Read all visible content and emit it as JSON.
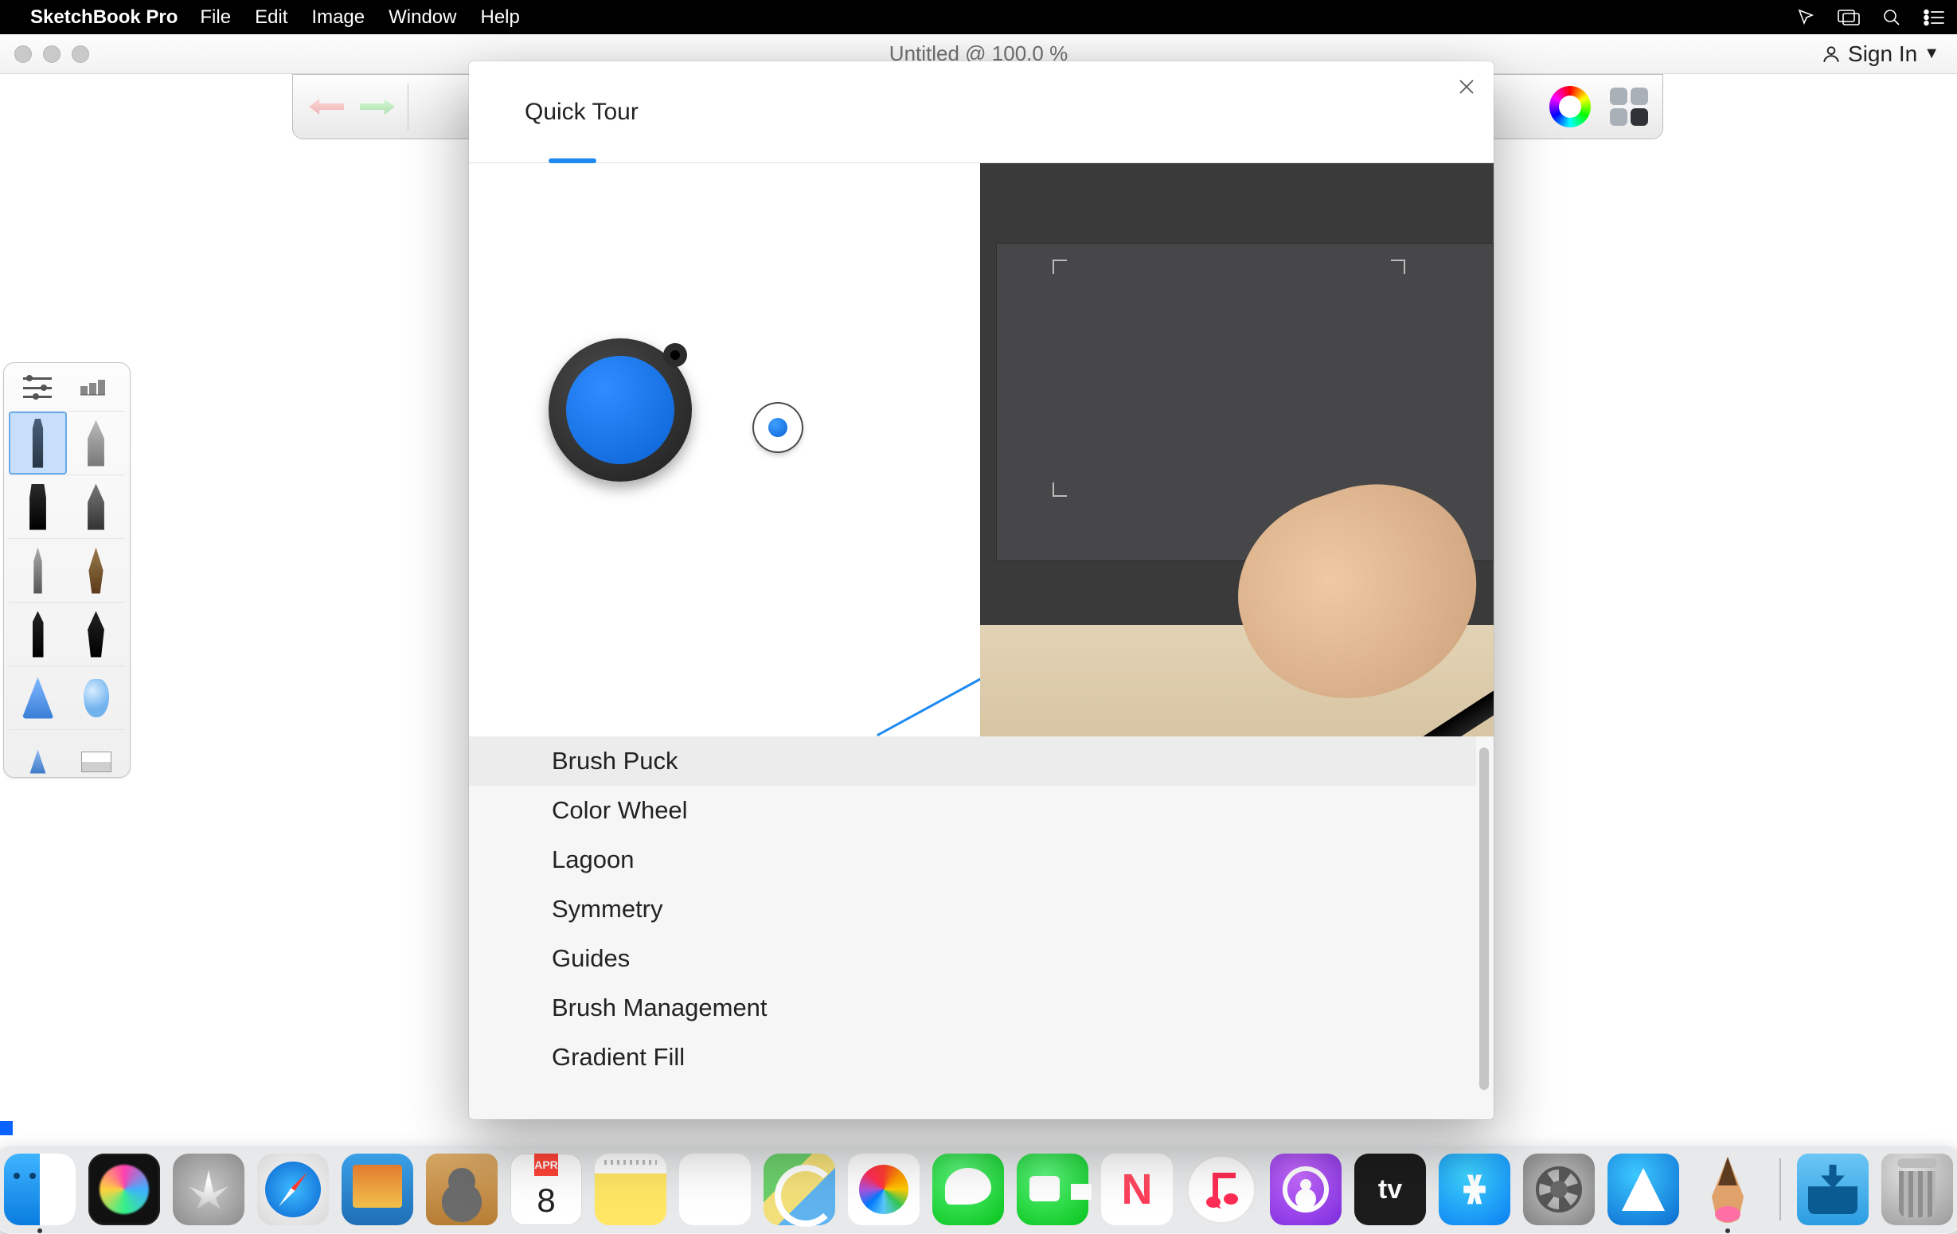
{
  "menubar": {
    "app_name": "SketchBook Pro",
    "items": [
      "File",
      "Edit",
      "Image",
      "Window",
      "Help"
    ]
  },
  "window": {
    "title": "Untitled @ 100.0 %",
    "signin_label": "Sign In"
  },
  "toolbar": {
    "undo_name": "undo",
    "redo_name": "redo",
    "color_wheel_name": "color-wheel",
    "ui_toggle_name": "ui-panels"
  },
  "brush_palette": {
    "brushes": [
      "Pencil",
      "Technical Pen",
      "Marker",
      "Chisel Marker",
      "Ballpoint",
      "Brush Pen",
      "Fine Liner",
      "Ink Brush",
      "Airbrush Cone",
      "Soft Airbrush",
      "Hard Cone",
      "Paint Swatch"
    ],
    "selected_index": 0
  },
  "quick_tour": {
    "title": "Quick Tour",
    "items": [
      "Brush Puck",
      "Color Wheel",
      "Lagoon",
      "Symmetry",
      "Guides",
      "Brush Management",
      "Gradient Fill"
    ],
    "selected_index": 0
  },
  "calendar": {
    "month": "APR",
    "day": "8"
  },
  "dock": {
    "apps": [
      "Finder",
      "Siri",
      "Launchpad",
      "Safari",
      "Preview",
      "Contacts",
      "Calendar",
      "Notes",
      "Reminders",
      "Maps",
      "Photos",
      "Messages",
      "FaceTime",
      "News",
      "Music",
      "Podcasts",
      "TV",
      "App Store",
      "System Preferences",
      "Affinity",
      "SketchBook"
    ],
    "right": [
      "Downloads",
      "Trash"
    ],
    "running": [
      "Finder",
      "SketchBook"
    ]
  }
}
